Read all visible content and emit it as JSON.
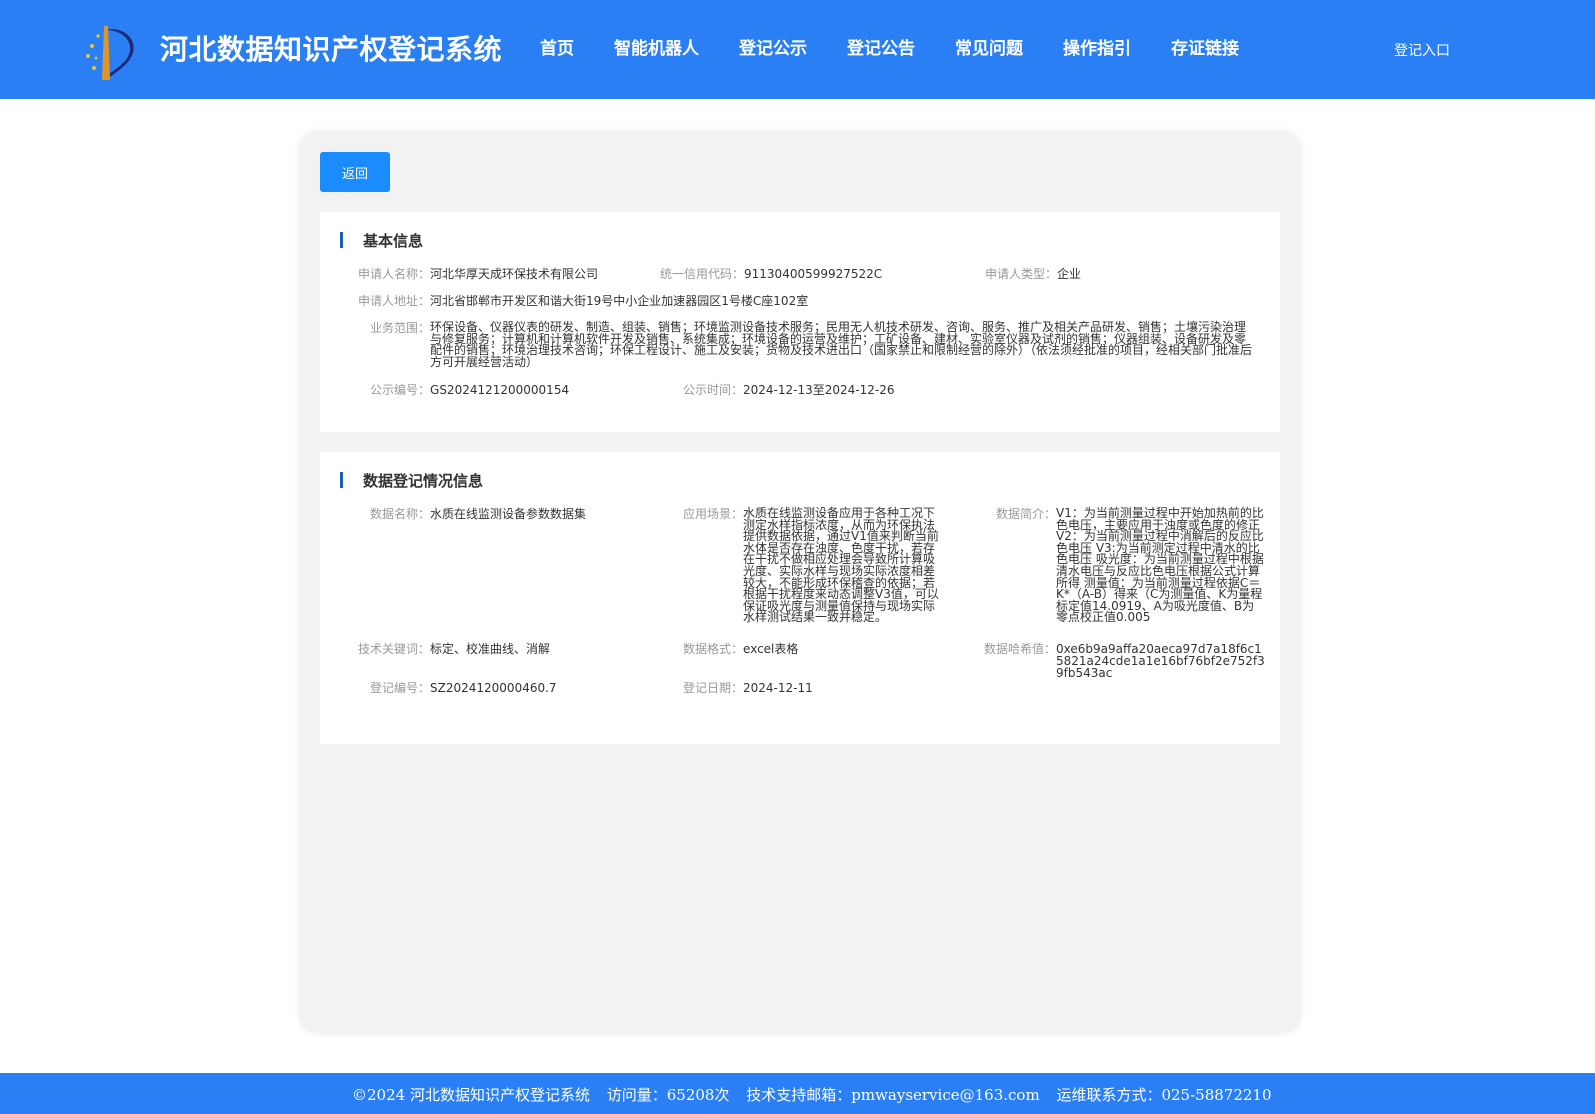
{
  "header": {
    "title": "河北数据知识产权登记系统",
    "nav": [
      "首页",
      "智能机器人",
      "登记公示",
      "登记公告",
      "常见问题",
      "操作指引",
      "存证链接"
    ],
    "login": "登记入口"
  },
  "back_label": "返回",
  "basic": {
    "title": "基本信息",
    "applicant_name_label": "申请人名称：",
    "applicant_name": "河北华厚天成环保技术有限公司",
    "credit_code_label": "统一信用代码：",
    "credit_code": "91130400599927522C",
    "applicant_type_label": "申请人类型：",
    "applicant_type": "企业",
    "address_label": "申请人地址：",
    "address": "河北省邯郸市开发区和谐大街19号中小企业加速器园区1号楼C座102室",
    "scope_label": "业务范围：",
    "scope": "环保设备、仪器仪表的研发、制造、组装、销售；环境监测设备技术服务；民用无人机技术研发、咨询、服务、推广及相关产品研发、销售；土壤污染治理与修复服务；计算机和计算机软件开发及销售、系统集成；环境设备的运营及维护；工矿设备、建材、实验室仪器及试剂的销售；仪器组装、设备研发及零配件的销售；环境治理技术咨询；环保工程设计、施工及安装；货物及技术进出口（国家禁止和限制经营的除外）（依法须经批准的项目，经相关部门批准后方可开展经营活动）",
    "pub_no_label": "公示编号：",
    "pub_no": "GS2024121200000154",
    "pub_time_label": "公示时间：",
    "pub_time": "2024-12-13至2024-12-26"
  },
  "data_reg": {
    "title": "数据登记情况信息",
    "data_name_label": "数据名称：",
    "data_name": "水质在线监测设备参数数据集",
    "scenario_label": "应用场景：",
    "scenario": "水质在线监测设备应用于各种工况下测定水样指标浓度，从而为环保执法提供数据依据，通过V1值来判断当前水体是否存在浊度、色度干扰，若存在干扰不做相应处理会导致所计算吸光度、实际水样与现场实际浓度相差较大，不能形成环保稽查的依据；若根据干扰程度来动态调整V3值，可以保证吸光度与测量值保持与现场实际水样测试结果一致并稳定。",
    "intro_label": "数据简介：",
    "intro": "V1：为当前测量过程中开始加热前的比色电压，主要应用于浊度或色度的修正 V2：为当前测量过程中消解后的反应比色电压 V3:为当前测定过程中清水的比色电压 吸光度：为当前测量过程中根据清水电压与反应比色电压根据公式计算所得 测量值：为当前测量过程依据C＝K*（A-B）得来（C为测量值、K为量程标定值14.0919、A为吸光度值、B为零点校正值0.005",
    "keywords_label": "技术关键词：",
    "keywords": "标定、校准曲线、消解",
    "format_label": "数据格式：",
    "format": "excel表格",
    "hash_label": "数据哈希值：",
    "hash": "0xe6b9a9affa20aeca97d7a18f6c15821a24cde1a1e16bf76bf2e752f39fb543ac",
    "reg_no_label": "登记编号：",
    "reg_no": "SZ2024120000460.7",
    "reg_date_label": "登记日期：",
    "reg_date": "2024-12-11"
  },
  "footer": {
    "copyright": "©2024 河北数据知识产权登记系统",
    "visits": "访问量：65208次",
    "email": "技术支持邮箱：pmwayservice@163.com",
    "contact": "运维联系方式：025-58872210"
  },
  "colors": {
    "header_bg": "#2a7ff5",
    "button": "#1a8cff",
    "accent_bar": "#1a5fb4",
    "panel_bg": "#f2f2f2"
  }
}
